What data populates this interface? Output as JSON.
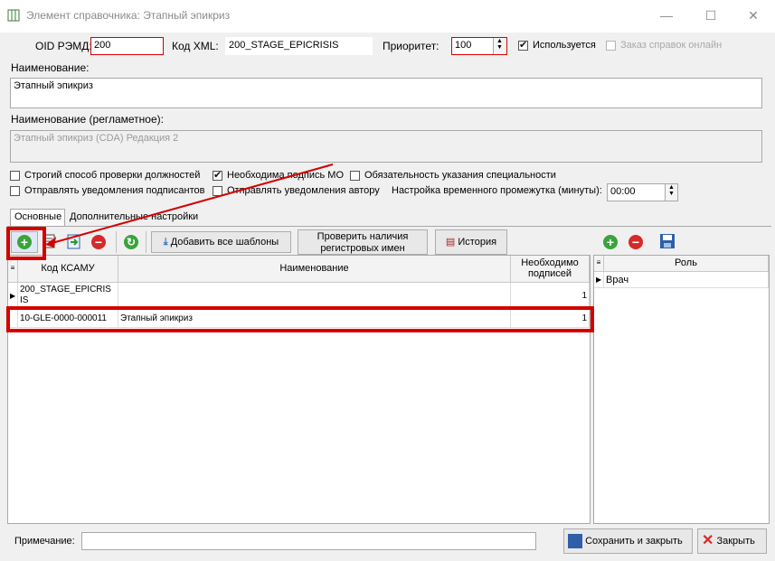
{
  "window": {
    "title": "Элемент справочника: Этапный эпикриз",
    "minimize": "—",
    "maximize": "☐",
    "close": "✕"
  },
  "form": {
    "oid_label": "OID РЭМД:",
    "oid_value": "200",
    "xml_label": "Код XML:",
    "xml_value": "200_STAGE_EPICRISIS",
    "priority_label": "Приоритет:",
    "priority_value": "100",
    "used_label": "Используется",
    "online_label": "Заказ справок онлайн",
    "name_label": "Наименование:",
    "name_value": "Этапный эпикриз",
    "reg_name_label": "Наименование (регламетное):",
    "reg_name_value": "Этапный эпикриз (CDA) Редакция 2",
    "strict_label": "Строгий способ проверки должностей",
    "mo_sign_label": "Необходима подпись МО",
    "spec_label": "Обязательность указания специальности",
    "notify_signers_label": "Отправлять уведомления подписантов",
    "notify_author_label": "Отправлять уведомления автору",
    "interval_label": "Настройка временного промежутка (минуты):",
    "interval_value": "00:00"
  },
  "tabs": {
    "main": "Основные",
    "extra": "Дополнительные настройки"
  },
  "toolbar": {
    "add_all_label": "Добавить все шаблоны",
    "check_label_1": "Проверить наличия",
    "check_label_2": "регистровых имен",
    "history_label": "История"
  },
  "table": {
    "headers": {
      "code": "Код КСАМУ",
      "name": "Наименование",
      "needed_1": "Необходимо",
      "needed_2": "подписей"
    },
    "rows": [
      {
        "code_1": "200_STAGE_EPICRIS",
        "code_2": "IS",
        "name": "",
        "count": "1"
      },
      {
        "code": "10-GLE-0000-000011",
        "name": "Этапный эпикриз",
        "count": "1"
      }
    ]
  },
  "roles": {
    "header": "Роль",
    "rows": [
      "Врач"
    ]
  },
  "footer": {
    "note_label": "Примечание:",
    "save_close": "Сохранить и закрыть",
    "close": "Закрыть"
  },
  "colors": {
    "highlight": "#d40000",
    "add": "#3aa33a",
    "remove": "#d42a2a"
  }
}
